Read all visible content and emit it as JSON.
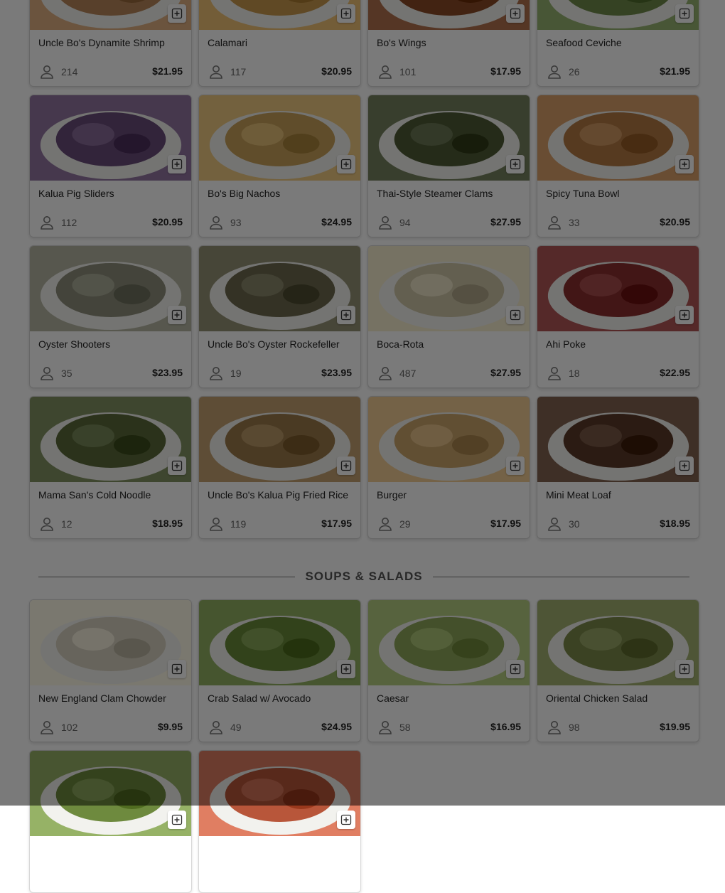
{
  "menu": {
    "top_items": [
      {
        "name": "Uncle Bo's Dynamite Shrimp",
        "count": "214",
        "price": "$21.95",
        "photo_color": "#b8875a",
        "photo_icon": "shrimp-photo"
      },
      {
        "name": "Calamari",
        "count": "117",
        "price": "$20.95",
        "photo_color": "#c99a4e",
        "photo_icon": "calamari-photo"
      },
      {
        "name": "Bo's Wings",
        "count": "101",
        "price": "$17.95",
        "photo_color": "#8a4a26",
        "photo_icon": "wings-photo"
      },
      {
        "name": "Seafood Ceviche",
        "count": "26",
        "price": "$21.95",
        "photo_color": "#6f8b4a",
        "photo_icon": "ceviche-photo"
      },
      {
        "name": "Kalua Pig Sliders",
        "count": "112",
        "price": "$20.95",
        "photo_color": "#6a4d7a",
        "photo_icon": "sliders-photo"
      },
      {
        "name": "Bo's Big Nachos",
        "count": "93",
        "price": "$24.95",
        "photo_color": "#c8a25a",
        "photo_icon": "nachos-photo"
      },
      {
        "name": "Thai-Style Steamer Clams",
        "count": "94",
        "price": "$27.95",
        "photo_color": "#4e5a36",
        "photo_icon": "clams-photo"
      },
      {
        "name": "Spicy Tuna Bowl",
        "count": "33",
        "price": "$20.95",
        "photo_color": "#b47a44",
        "photo_icon": "tuna-bowl-photo"
      },
      {
        "name": "Oyster Shooters",
        "count": "35",
        "price": "$23.95",
        "photo_color": "#8e8f7c",
        "photo_icon": "oyster-shooters-photo"
      },
      {
        "name": "Uncle Bo's Oyster Rockefeller",
        "count": "19",
        "price": "$23.95",
        "photo_color": "#6d6a4e",
        "photo_icon": "oyster-rockefeller-photo"
      },
      {
        "name": "Boca-Rota",
        "count": "487",
        "price": "$27.95",
        "photo_color": "#cfc6a8",
        "photo_icon": "boca-rota-photo"
      },
      {
        "name": "Ahi Poke",
        "count": "18",
        "price": "$22.95",
        "photo_color": "#8a2e2e",
        "photo_icon": "ahi-poke-photo"
      },
      {
        "name": "Mama San's Cold Noodle",
        "count": "12",
        "price": "$18.95",
        "photo_color": "#5a6a3a",
        "photo_icon": "cold-noodle-photo"
      },
      {
        "name": "Uncle Bo's Kalua Pig Fried Rice",
        "count": "119",
        "price": "$17.95",
        "photo_color": "#9c7a4a",
        "photo_icon": "fried-rice-photo"
      },
      {
        "name": "Burger",
        "count": "29",
        "price": "$17.95",
        "photo_color": "#caa56c",
        "photo_icon": "burger-photo"
      },
      {
        "name": "Mini Meat Loaf",
        "count": "30",
        "price": "$18.95",
        "photo_color": "#5b3a28",
        "photo_icon": "meat-loaf-photo"
      }
    ]
  },
  "soups_section": {
    "heading": "SOUPS & SALADS",
    "items": [
      {
        "name": "New England Clam Chowder",
        "count": "102",
        "price": "$9.95",
        "photo_color": "#d8d2c0",
        "photo_icon": "clam-chowder-photo"
      },
      {
        "name": "Crab Salad w/ Avocado",
        "count": "49",
        "price": "$24.95",
        "photo_color": "#6a8a3a",
        "photo_icon": "crab-salad-photo"
      },
      {
        "name": "Caesar",
        "count": "58",
        "price": "$16.95",
        "photo_color": "#8fa85a",
        "photo_icon": "caesar-photo"
      },
      {
        "name": "Oriental Chicken Salad",
        "count": "98",
        "price": "$19.95",
        "photo_color": "#7c8a4a",
        "photo_icon": "chicken-salad-photo"
      },
      {
        "name": "",
        "count": "",
        "price": "",
        "photo_color": "#6e8a3e",
        "photo_icon": "salad-photo"
      },
      {
        "name": "",
        "count": "",
        "price": "",
        "photo_color": "#b8563a",
        "photo_icon": "tomato-salad-photo"
      }
    ]
  },
  "icons": {
    "add": "plus-icon",
    "people": "person-icon"
  },
  "colors": {
    "overlay": "rgba(0,0,0,0.52)",
    "price_text": "#222222"
  }
}
